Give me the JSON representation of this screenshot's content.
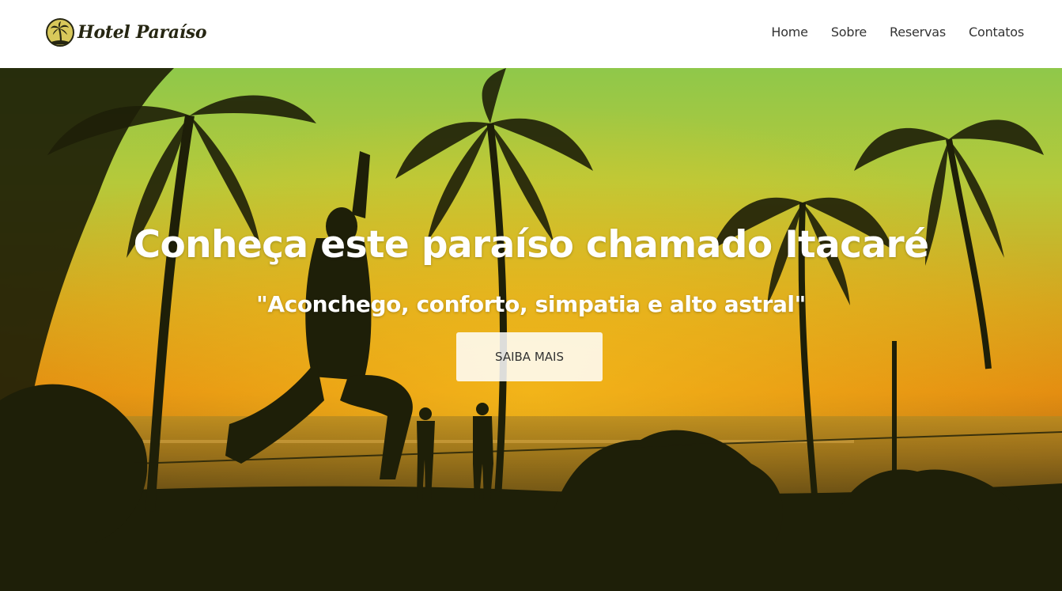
{
  "brand": {
    "name": "Hotel Paraíso",
    "logo_icon": "palm-tree-icon"
  },
  "nav": {
    "items": [
      {
        "label": "Home"
      },
      {
        "label": "Sobre"
      },
      {
        "label": "Reservas"
      },
      {
        "label": "Contatos"
      }
    ]
  },
  "hero": {
    "title": "Conheça este paraíso chamado Itacaré",
    "subtitle": "\"Aconchego, conforto, simpatia e alto astral\"",
    "cta_label": "SAIBA MAIS"
  },
  "colors": {
    "header_bg": "#ffffff",
    "nav_text": "#333333",
    "hero_text": "#ffffff",
    "sky_top": "#8fc84a",
    "sunset_orange": "#e38a10",
    "silhouette": "#1e1f08"
  }
}
